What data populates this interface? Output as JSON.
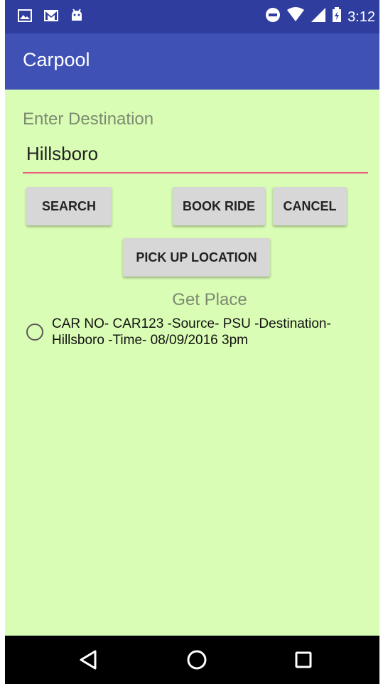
{
  "status_bar": {
    "time": "3:12",
    "left_icons": [
      "image-icon",
      "gmail-icon",
      "android-icon"
    ],
    "right_icons": [
      "do-not-disturb-icon",
      "wifi-icon",
      "signal-icon",
      "battery-icon"
    ]
  },
  "app_bar": {
    "title": "Carpool"
  },
  "form": {
    "destination_label": "Enter Destination",
    "destination_value": "Hillsboro",
    "search_label": "SEARCH",
    "book_ride_label": "BOOK RIDE",
    "cancel_label": "CANCEL",
    "pickup_label": "PICK UP LOCATION",
    "get_place_label": "Get Place"
  },
  "rides": [
    {
      "text": "CAR NO- CAR123 -Source- PSU -Destination- Hillsboro -Time- 08/09/2016 3pm",
      "selected": false
    }
  ],
  "nav_bar": {
    "icons": [
      "back-icon",
      "home-icon",
      "recents-icon"
    ]
  },
  "colors": {
    "status_bar": "#2f3e9e",
    "app_bar": "#3f51b5",
    "background": "#d9fdb4",
    "accent": "#ee5a7c",
    "button": "#d6d7d6"
  }
}
